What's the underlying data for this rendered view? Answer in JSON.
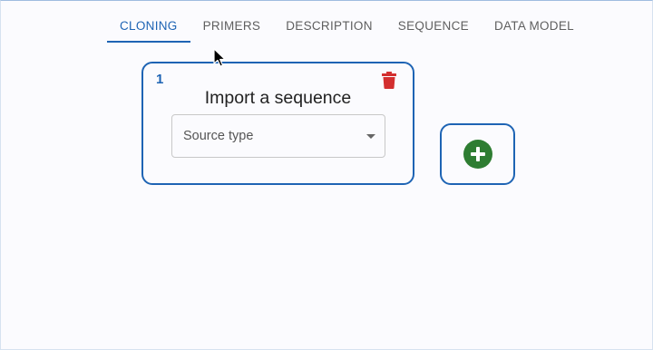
{
  "tabs": [
    {
      "label": "CLONING",
      "active": true
    },
    {
      "label": "PRIMERS",
      "active": false
    },
    {
      "label": "DESCRIPTION",
      "active": false
    },
    {
      "label": "SEQUENCE",
      "active": false
    },
    {
      "label": "DATA MODEL",
      "active": false
    }
  ],
  "source_card": {
    "number": "1",
    "title": "Import a sequence",
    "select_placeholder": "Source type",
    "delete_icon": "trash-icon"
  },
  "add_card": {
    "icon": "plus-circle-icon"
  },
  "colors": {
    "accent": "#1e64b4",
    "delete": "#d32f2f",
    "add": "#2e7d32"
  }
}
